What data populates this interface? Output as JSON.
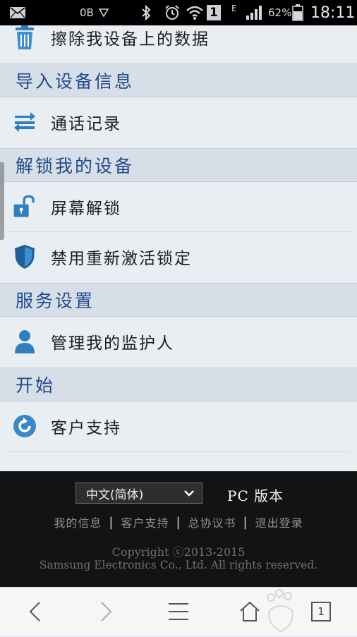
{
  "status_bar": {
    "data_rate": "0B",
    "battery_percent": "62%",
    "sim_badge": "1",
    "network_type": "E",
    "time": "18:11"
  },
  "menu": {
    "items": [
      {
        "label": "擦除我设备上的数据",
        "icon": "trash-icon"
      },
      {
        "label": "通话记录",
        "icon": "list-icon"
      },
      {
        "label": "屏幕解锁",
        "icon": "unlock-icon"
      },
      {
        "label": "禁用重新激活锁定",
        "icon": "shield-icon"
      },
      {
        "label": "管理我的监护人",
        "icon": "person-icon"
      },
      {
        "label": "客户支持",
        "icon": "support-icon"
      }
    ],
    "sections": [
      {
        "title": "导入设备信息"
      },
      {
        "title": "解锁我的设备"
      },
      {
        "title": "服务设置"
      },
      {
        "title": "开始"
      }
    ]
  },
  "footer": {
    "language_value": "中文(简体)",
    "pc_link": "PC 版本",
    "links": [
      "我的信息",
      "客户支持",
      "总协议书",
      "退出登录"
    ],
    "copyright_line1": "Copyright ⓒ2013-2015",
    "copyright_line2": "Samsung Electronics Co., Ltd. All rights reserved."
  },
  "browser_nav": {
    "tab_count": "1"
  },
  "colors": {
    "section_title": "#214a8a",
    "icon_blue": "#2f7fbf",
    "footer_bg": "#131313"
  }
}
